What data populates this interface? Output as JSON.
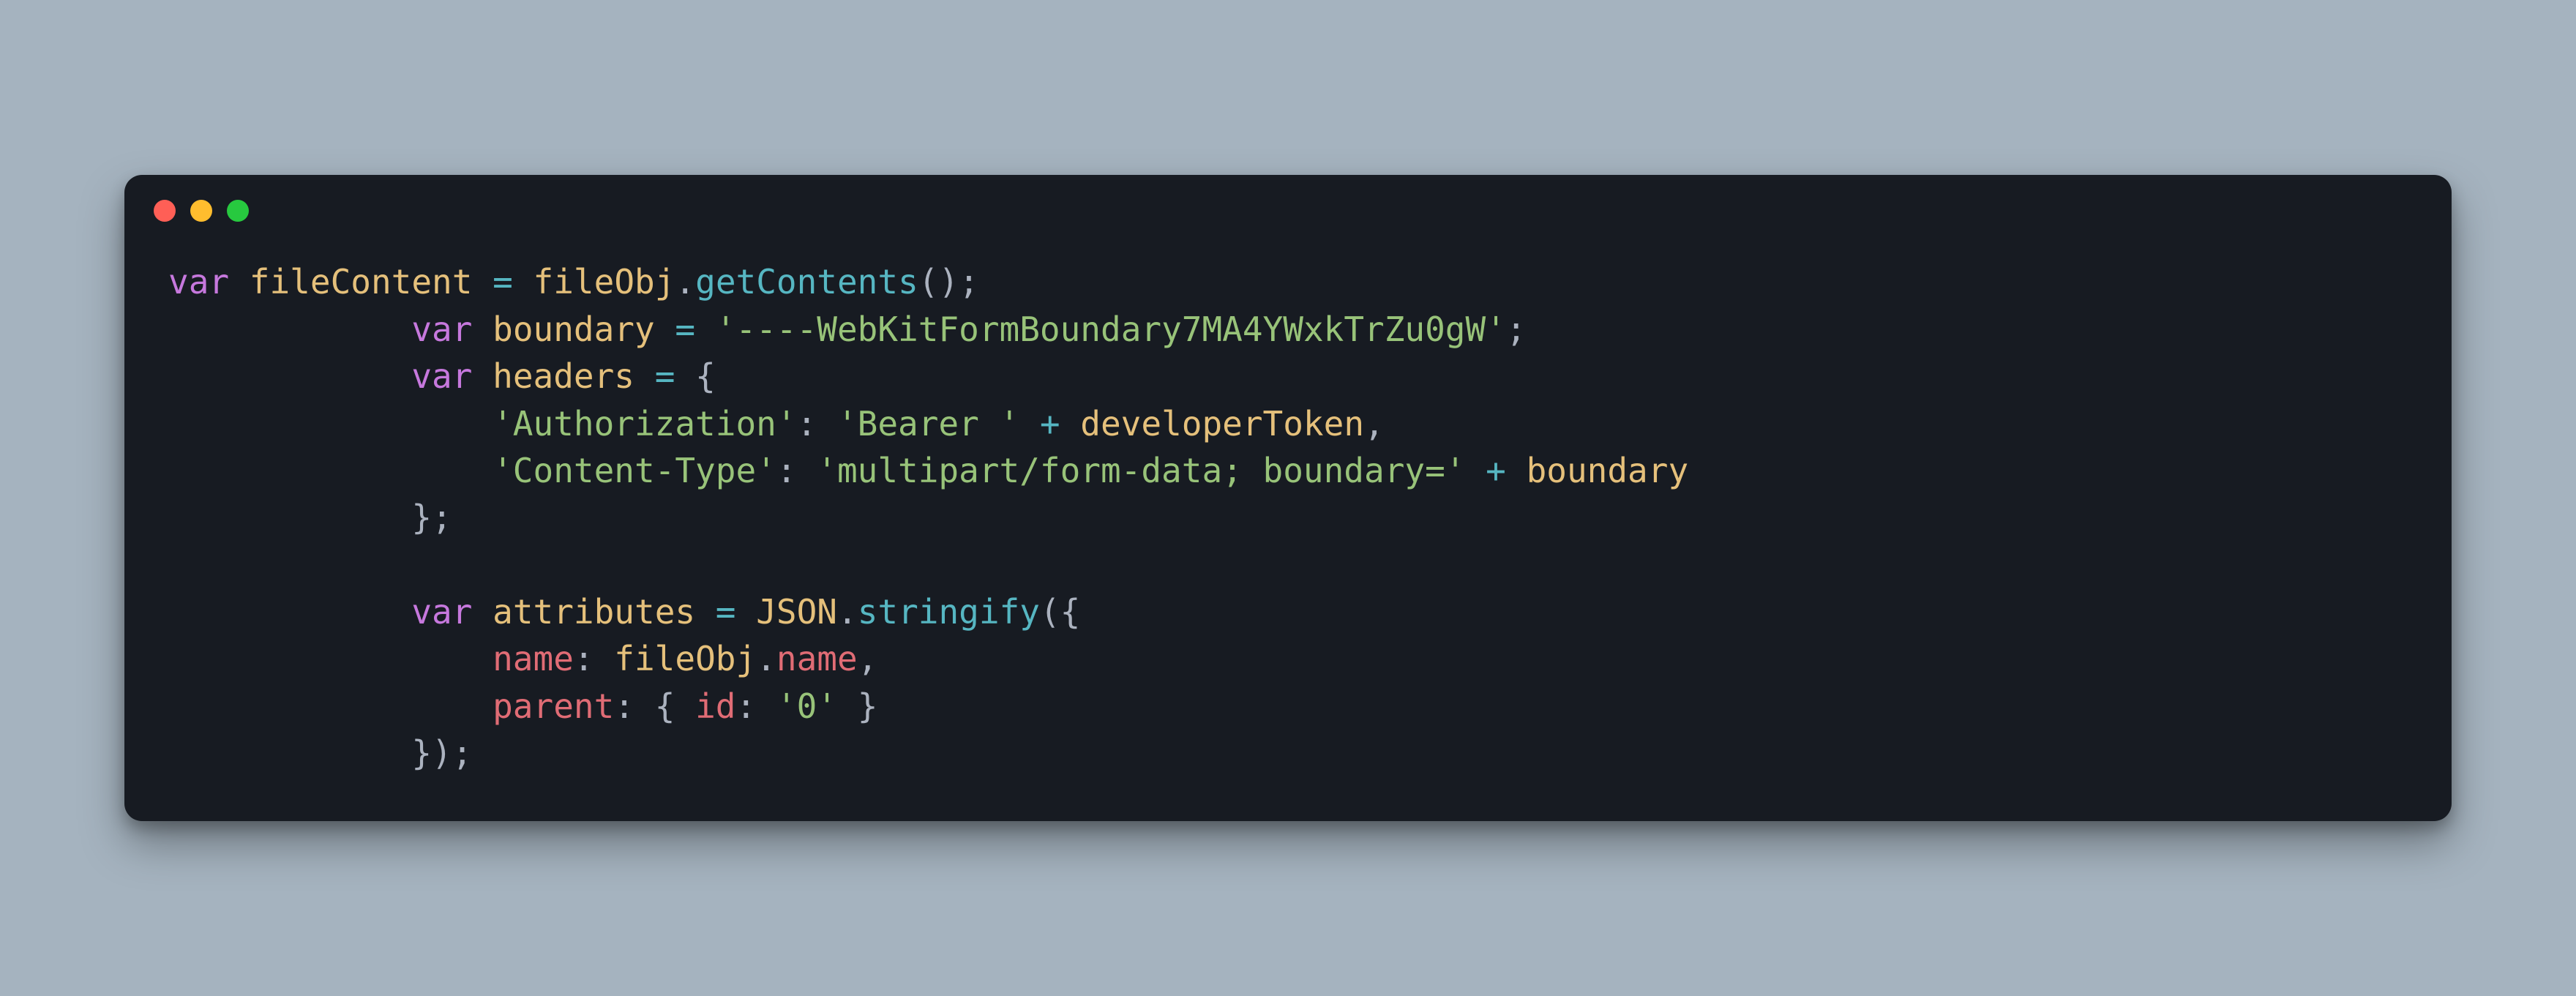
{
  "window": {
    "traffic_lights": [
      "red",
      "yellow",
      "green"
    ]
  },
  "code": {
    "indent1": "            ",
    "indent2": "                ",
    "l1": {
      "kw": "var",
      "ident": "fileContent",
      "eq": "=",
      "obj": "fileObj",
      "dot": ".",
      "method": "getContents",
      "call": "();"
    },
    "l2": {
      "kw": "var",
      "ident": "boundary",
      "eq": "=",
      "str": "'----WebKitFormBoundary7MA4YWxkTrZu0gW'",
      "semi": ";"
    },
    "l3": {
      "kw": "var",
      "ident": "headers",
      "eq": "=",
      "brace": "{"
    },
    "l4": {
      "key": "'Authorization'",
      "colon": ":",
      "str": "'Bearer '",
      "plus": "+",
      "ident": "developerToken",
      "comma": ","
    },
    "l5": {
      "key": "'Content-Type'",
      "colon": ":",
      "str": "'multipart/form-data; boundary='",
      "plus": "+",
      "ident": "boundary"
    },
    "l6": {
      "brace": "};"
    },
    "l8": {
      "kw": "var",
      "ident": "attributes",
      "eq": "=",
      "obj": "JSON",
      "dot": ".",
      "method": "stringify",
      "open": "({"
    },
    "l9": {
      "key": "name",
      "colon": ":",
      "obj": "fileObj",
      "dot": ".",
      "prop": "name",
      "comma": ","
    },
    "l10": {
      "key": "parent",
      "colon": ":",
      "open": "{",
      "innerkey": "id",
      "innercolon": ":",
      "str": "'0'",
      "close": "}"
    },
    "l11": {
      "close": "});"
    }
  }
}
